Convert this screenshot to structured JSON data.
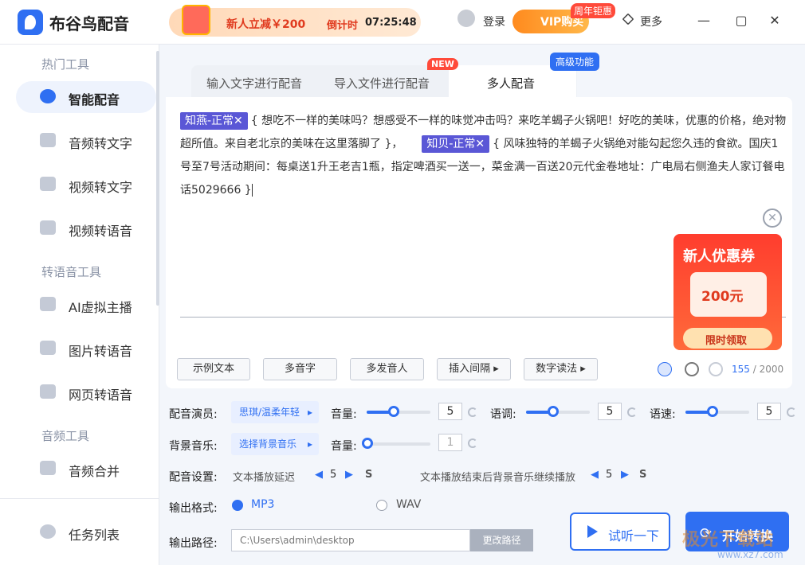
{
  "app": {
    "title": "布谷鸟配音"
  },
  "promo": {
    "text": "新人立减￥200",
    "countdown_label": "倒计时",
    "countdown": "07:25:48"
  },
  "header": {
    "login": "登录",
    "vip_label": "VIP购买",
    "vip_badge": "周年钜惠",
    "more": "更多"
  },
  "window": {
    "minimize": "—",
    "maximize": "▢",
    "close": "✕"
  },
  "sidebar": {
    "sections": [
      "热门工具",
      "转语音工具",
      "音频工具"
    ],
    "items": [
      {
        "label": "智能配音",
        "icon": "smart-dubbing-icon",
        "active": true
      },
      {
        "label": "音频转文字",
        "icon": "audio-to-text-icon"
      },
      {
        "label": "视频转文字",
        "icon": "video-to-text-icon"
      },
      {
        "label": "视频转语音",
        "icon": "video-to-audio-icon"
      },
      {
        "label": "AI虚拟主播",
        "icon": "ai-anchor-icon"
      },
      {
        "label": "图片转语音",
        "icon": "image-to-audio-icon"
      },
      {
        "label": "网页转语音",
        "icon": "web-to-audio-icon"
      },
      {
        "label": "音频合并",
        "icon": "audio-merge-icon"
      }
    ],
    "task_list": "任务列表"
  },
  "tabs": [
    {
      "label": "输入文字进行配音"
    },
    {
      "label": "导入文件进行配音",
      "badge": "NEW"
    },
    {
      "label": "多人配音",
      "badge": "高级功能",
      "active": true
    }
  ],
  "editor": {
    "chip1": "知燕-正常✕",
    "segment1": "{ 想吃不一样的美味吗？想感受不一样的味觉冲击吗？来吃羊蝎子火锅吧！好吃的美味，优惠的价格，绝对物超所值。来自老北京的美味在这里落脚了 }，",
    "chip2": "知贝-正常✕",
    "segment2": "{ 风味独特的羊蝎子火锅绝对能勾起您久违的食欲。国庆1号至7号活动期间：每桌送1升王老吉1瓶，指定啤酒买一送一，菜金满一百送20元代金卷地址：广电局右侧渔夫人家订餐电话5029666 }"
  },
  "coupon": {
    "title": "新人优惠券",
    "amount": "200元",
    "button": "限时领取",
    "close": "✕"
  },
  "toolbar": {
    "buttons": [
      "示例文本",
      "多音字",
      "多发音人",
      "插入间隔 ▸",
      "数字读法 ▸"
    ],
    "count": "155",
    "max": " / 2000"
  },
  "settings": {
    "voice_label": "配音演员:",
    "voice_value": "思琪/温柔年轻",
    "volume_label": "音量:",
    "volume_value": "5",
    "tone_label": "语调:",
    "tone_value": "5",
    "speed_label": "语速:",
    "speed_value": "5",
    "bgm_label": "背景音乐:",
    "bgm_value": "选择背景音乐",
    "bgm_volume_label": "音量:",
    "bgm_volume_value": "1",
    "config_label": "配音设置:",
    "delay_label": "文本播放延迟",
    "delay_value": "5",
    "delay_unit": "S",
    "bgm_continue_label": "文本播放结束后背景音乐继续播放",
    "bgm_continue_value": "5",
    "bgm_continue_unit": "S",
    "format_label": "输出格式:",
    "format_mp3": "MP3",
    "format_wav": "WAV",
    "path_label": "输出路径:",
    "path_value": "C:\\Users\\admin\\desktop",
    "path_button": "更改路径"
  },
  "actions": {
    "listen": "试听一下",
    "start": "开始转换"
  },
  "watermark": {
    "text": "极光下载站",
    "url": "www.xz7.com"
  },
  "colors": {
    "accent": "#2f6ff2",
    "chip": "#5a57d6",
    "promo": "#e03a1e",
    "coupon": "#ff3d2e"
  }
}
